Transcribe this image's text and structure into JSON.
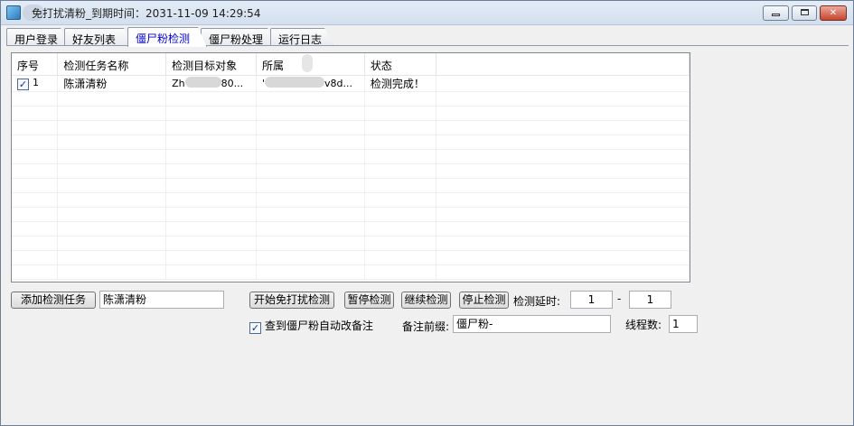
{
  "window": {
    "title": "免打扰清粉_到期时间：2031-11-09 14:29:54",
    "minimize_label": "",
    "maximize_label": "",
    "close_label": "✕"
  },
  "tabs": [
    {
      "label": "用户登录",
      "active": false
    },
    {
      "label": "好友列表",
      "active": false
    },
    {
      "label": "僵尸粉检测",
      "active": true
    },
    {
      "label": "僵尸粉处理",
      "active": false
    },
    {
      "label": "运行日志",
      "active": false
    }
  ],
  "grid": {
    "columns": [
      "序号",
      "检测任务名称",
      "检测目标对象",
      "所属",
      "状态"
    ],
    "rows": [
      {
        "checked": true,
        "index": "1",
        "task_name": "陈潇清粉",
        "target_prefix": "Zh",
        "target_suffix": "80...",
        "owner_prefix": "'",
        "owner_suffix": "v8d...",
        "status": "检测完成！"
      }
    ]
  },
  "controls": {
    "add_task_button": "添加检测任务",
    "task_name_value": "陈潇清粉",
    "start_button": "开始免打扰检测",
    "pause_button": "暂停检测",
    "resume_button": "继续检测",
    "stop_button": "停止检测",
    "delay_label": "检测延时:",
    "delay_min": "1",
    "delay_sep": "-",
    "delay_max": "1",
    "auto_remark_label": "查到僵尸粉自动改备注",
    "auto_remark_checked": true,
    "remark_prefix_label": "备注前缀:",
    "remark_prefix_value": "僵尸粉-",
    "threads_label": "线程数:",
    "threads_value": "1"
  }
}
